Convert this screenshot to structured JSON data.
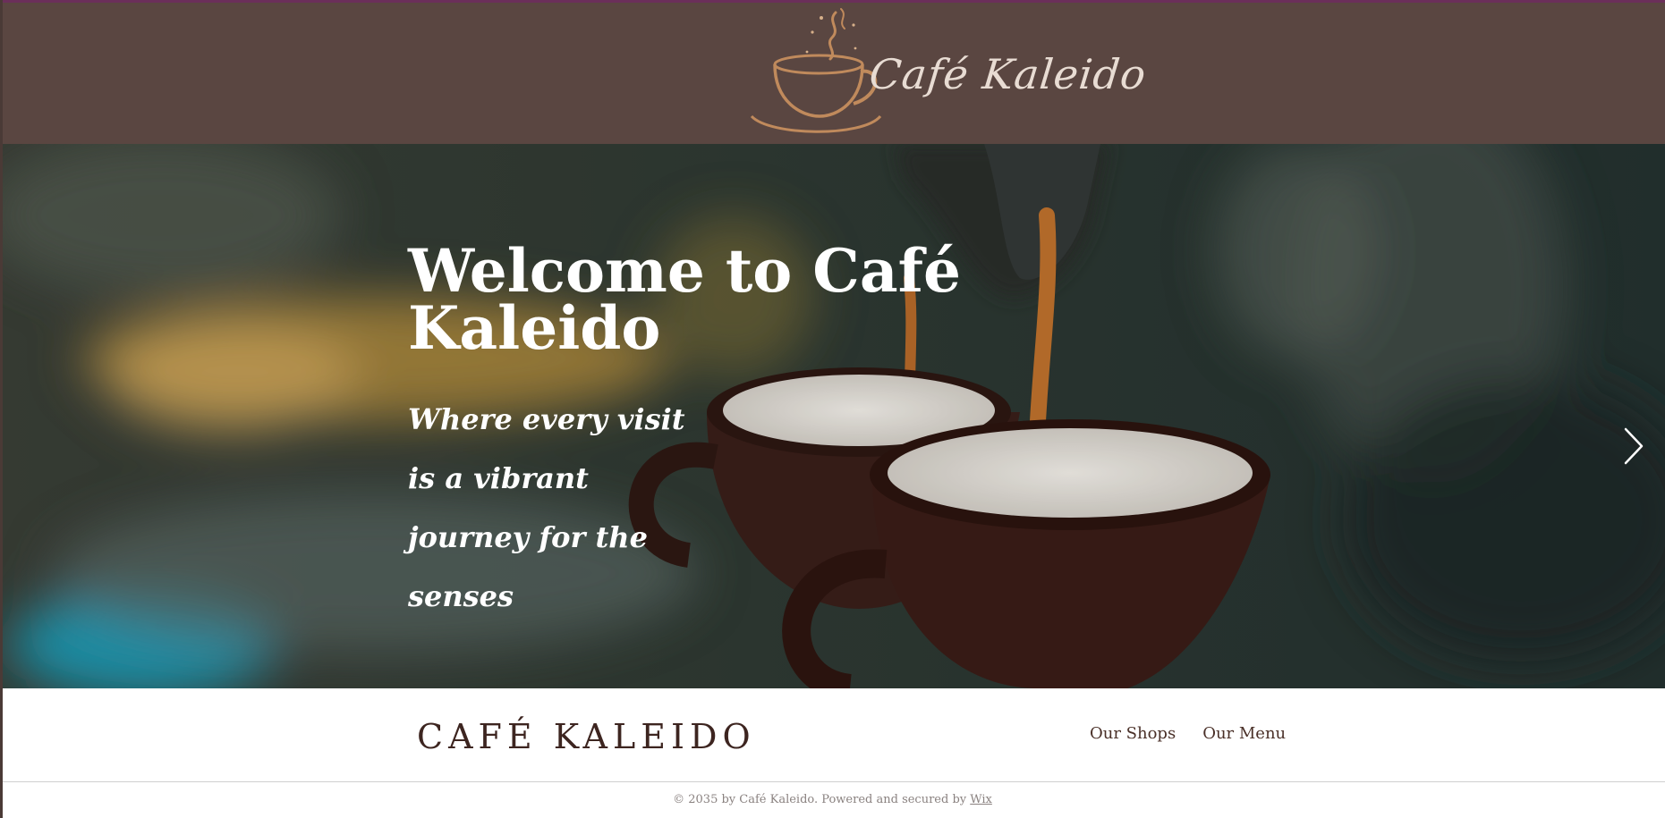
{
  "header": {
    "logo_text": "Café Kaleido",
    "logo_icon": "coffee-cup-icon"
  },
  "hero": {
    "title": "Welcome to Café Kaleido",
    "subtitle": "Where every visit is a vibrant journey for the senses",
    "next_icon": "chevron-right-icon"
  },
  "footer": {
    "brand": "CAFÉ KALEIDO",
    "nav": [
      {
        "label": "Our Shops"
      },
      {
        "label": "Our Menu"
      }
    ],
    "copyright_prefix": "© 2035 by Café Kaleido. Powered and secured by ",
    "copyright_link": "Wix"
  },
  "colors": {
    "header_bg": "#5a4641",
    "logo_accent": "#c08a5c",
    "brand_text": "#3d2520",
    "top_accent": "#6b2f5a"
  }
}
